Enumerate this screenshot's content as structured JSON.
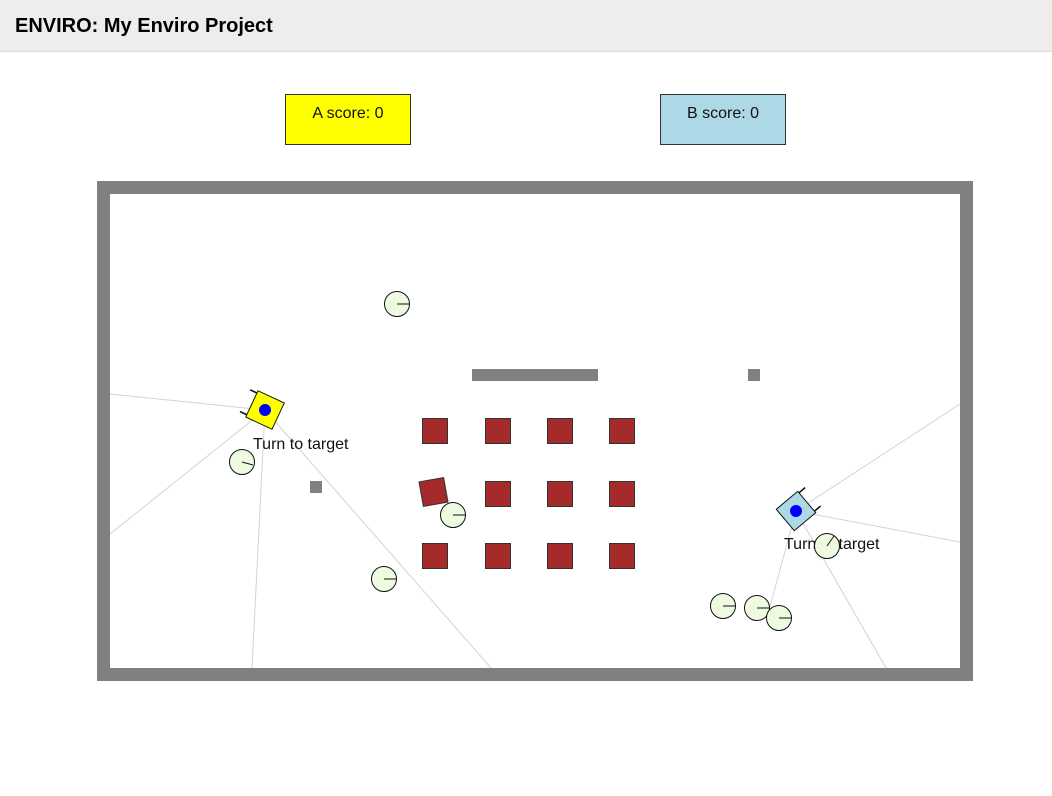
{
  "header": {
    "title": "ENVIRO: My Enviro Project"
  },
  "scores": {
    "a": {
      "label": "A score: 0",
      "color": "#ffff00"
    },
    "b": {
      "label": "B score: 0",
      "color": "#add8e6"
    }
  },
  "colors": {
    "wall": "#808080",
    "block": "#a52a2a",
    "ball": "#eefbe0",
    "sensor_ray": "#d3d3d3",
    "robot_eye": "#0000ff"
  },
  "robots": {
    "a": {
      "status": "Turn to target",
      "color": "#ffff00"
    },
    "b": {
      "status": "Turn to target",
      "color": "#add8e6"
    }
  }
}
